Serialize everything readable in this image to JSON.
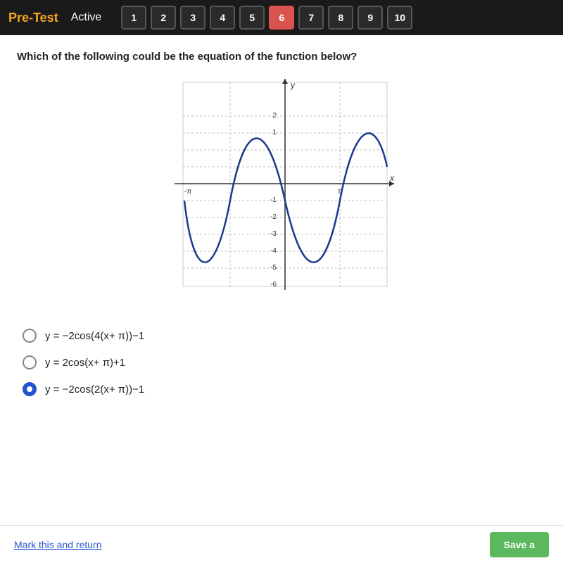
{
  "header": {
    "title": "Pre-Test",
    "status": "Active"
  },
  "tabs": [
    {
      "label": "1",
      "active": false
    },
    {
      "label": "2",
      "active": false
    },
    {
      "label": "3",
      "active": false
    },
    {
      "label": "4",
      "active": false
    },
    {
      "label": "5",
      "active": false
    },
    {
      "label": "6",
      "active": true
    },
    {
      "label": "7",
      "active": false
    },
    {
      "label": "8",
      "active": false
    },
    {
      "label": "9",
      "active": false
    },
    {
      "label": "10",
      "active": false
    }
  ],
  "question": {
    "text": "Which of the following could be the equation of the function below?"
  },
  "choices": [
    {
      "id": "a",
      "label": "y = −2cos(4(x+ π))−1",
      "selected": false
    },
    {
      "id": "b",
      "label": "y = 2cos(x+ π)+1",
      "selected": false
    },
    {
      "id": "c",
      "label": "y = −2cos(2(x+ π))−1",
      "selected": true
    }
  ],
  "footer": {
    "mark_return": "Mark this and return",
    "save": "Save a"
  }
}
